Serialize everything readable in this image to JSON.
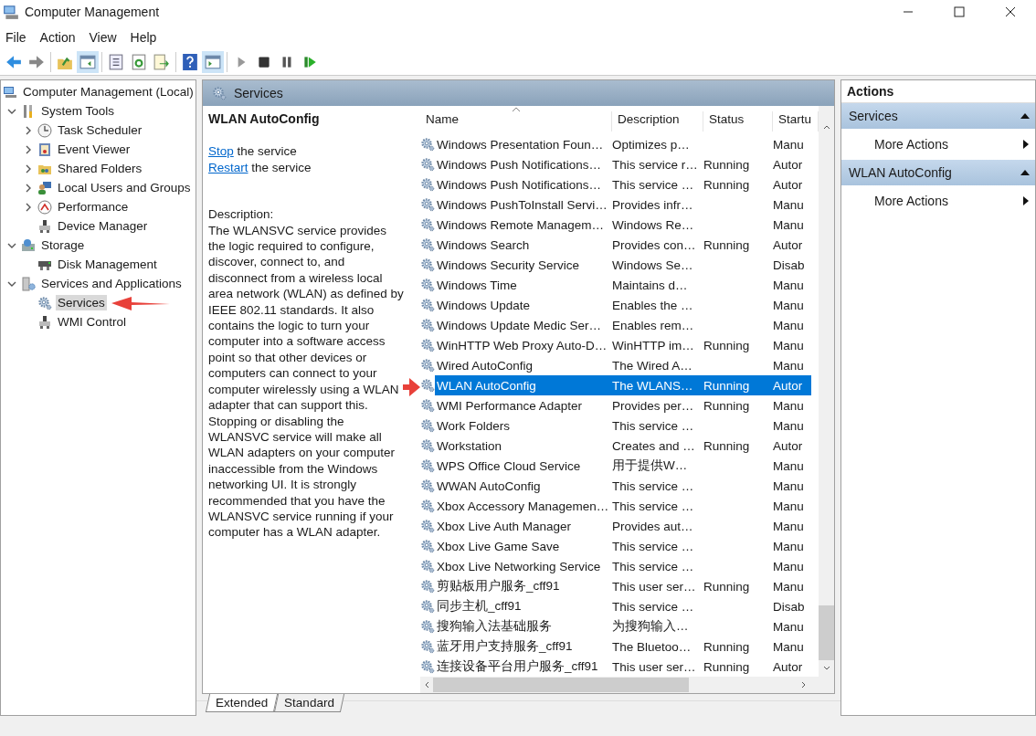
{
  "window": {
    "title": "Computer Management"
  },
  "menu": [
    "File",
    "Action",
    "View",
    "Help"
  ],
  "toolbar": [
    [
      {
        "kind": "back",
        "selected": false
      },
      {
        "kind": "forward",
        "selected": false
      }
    ],
    [
      {
        "kind": "up-folder",
        "selected": false
      },
      {
        "kind": "console-tree",
        "selected": true
      }
    ],
    [
      {
        "kind": "properties",
        "selected": false
      },
      {
        "kind": "refresh",
        "selected": false
      },
      {
        "kind": "export",
        "selected": false
      }
    ],
    [
      {
        "kind": "help",
        "selected": false
      },
      {
        "kind": "action-pane",
        "selected": true
      }
    ],
    [
      {
        "kind": "play",
        "selected": false
      },
      {
        "kind": "stop",
        "selected": false
      },
      {
        "kind": "pause",
        "selected": false
      },
      {
        "kind": "resume",
        "selected": false
      }
    ]
  ],
  "tree": [
    {
      "label": "Computer Management (Local)",
      "kind": "computer",
      "selected": false,
      "children": [
        {
          "label": "System Tools",
          "kind": "tools",
          "expanded": true,
          "selected": false,
          "children": [
            {
              "label": "Task Scheduler",
              "kind": "clock",
              "expanded": false,
              "selected": false
            },
            {
              "label": "Event Viewer",
              "kind": "log",
              "expanded": false,
              "selected": false
            },
            {
              "label": "Shared Folders",
              "kind": "folder",
              "expanded": false,
              "selected": false
            },
            {
              "label": "Local Users and Groups",
              "kind": "users",
              "expanded": false,
              "selected": false
            },
            {
              "label": "Performance",
              "kind": "gauge",
              "expanded": false,
              "selected": false
            },
            {
              "label": "Device Manager",
              "kind": "device",
              "selected": false
            }
          ]
        },
        {
          "label": "Storage",
          "kind": "storage",
          "expanded": true,
          "selected": false,
          "children": [
            {
              "label": "Disk Management",
              "kind": "disk",
              "selected": false
            }
          ]
        },
        {
          "label": "Services and Applications",
          "kind": "server",
          "expanded": true,
          "selected": false,
          "children": [
            {
              "label": "Services",
              "kind": "gear",
              "selected": true
            },
            {
              "label": "WMI Control",
              "kind": "device",
              "selected": false
            }
          ]
        }
      ]
    }
  ],
  "services_panel": {
    "title": "Services",
    "detail": {
      "name": "WLAN AutoConfig",
      "actions": [
        {
          "link": "Stop",
          "text": "the service"
        },
        {
          "link": "Restart",
          "text": "the service"
        }
      ],
      "description_label": "Description:",
      "description": "The WLANSVC service provides the logic required to configure, discover, connect to, and disconnect from a wireless local area network (WLAN) as defined by IEEE 802.11 standards. It also contains the logic to turn your computer into a software access point so that other devices or computers can connect to your computer wirelessly using a WLAN adapter that can support this. Stopping or disabling the WLANSVC service will make all WLAN adapters on your computer inaccessible from the Windows networking UI. It is strongly recommended that you have the WLANSVC service running if your computer has a WLAN adapter."
    },
    "table": {
      "columns": [
        "Name",
        "Description",
        "Status",
        "Startu"
      ],
      "rows": [
        {
          "name": "Windows Presentation Foun…",
          "description": "Optimizes p…",
          "startup": "Manu",
          "selected": false
        },
        {
          "name": "Windows Push Notifications…",
          "description": "This service r…",
          "status": "Running",
          "startup": "Autor",
          "selected": false
        },
        {
          "name": "Windows Push Notifications…",
          "description": "This service …",
          "status": "Running",
          "startup": "Autor",
          "selected": false
        },
        {
          "name": "Windows PushToInstall Servi…",
          "description": "Provides infr…",
          "startup": "Manu",
          "selected": false
        },
        {
          "name": "Windows Remote Managem…",
          "description": "Windows Re…",
          "startup": "Manu",
          "selected": false
        },
        {
          "name": "Windows Search",
          "description": "Provides con…",
          "status": "Running",
          "startup": "Autor",
          "selected": false
        },
        {
          "name": "Windows Security Service",
          "description": "Windows Se…",
          "startup": "Disab",
          "selected": false
        },
        {
          "name": "Windows Time",
          "description": "Maintains d…",
          "startup": "Manu",
          "selected": false
        },
        {
          "name": "Windows Update",
          "description": "Enables the …",
          "startup": "Manu",
          "selected": false
        },
        {
          "name": "Windows Update Medic Ser…",
          "description": "Enables rem…",
          "startup": "Manu",
          "selected": false
        },
        {
          "name": "WinHTTP Web Proxy Auto-D…",
          "description": "WinHTTP im…",
          "status": "Running",
          "startup": "Manu",
          "selected": false
        },
        {
          "name": "Wired AutoConfig",
          "description": "The Wired A…",
          "startup": "Manu",
          "selected": false
        },
        {
          "name": "WLAN AutoConfig",
          "description": "The WLANS…",
          "status": "Running",
          "startup": "Autor",
          "selected": true
        },
        {
          "name": "WMI Performance Adapter",
          "description": "Provides per…",
          "status": "Running",
          "startup": "Manu",
          "selected": false
        },
        {
          "name": "Work Folders",
          "description": "This service …",
          "startup": "Manu",
          "selected": false
        },
        {
          "name": "Workstation",
          "description": "Creates and …",
          "status": "Running",
          "startup": "Autor",
          "selected": false
        },
        {
          "name": "WPS Office Cloud Service",
          "description": "用于提供W…",
          "startup": "Manu",
          "selected": false
        },
        {
          "name": "WWAN AutoConfig",
          "description": "This service …",
          "startup": "Manu",
          "selected": false
        },
        {
          "name": "Xbox Accessory Managemen…",
          "description": "This service …",
          "startup": "Manu",
          "selected": false
        },
        {
          "name": "Xbox Live Auth Manager",
          "description": "Provides aut…",
          "startup": "Manu",
          "selected": false
        },
        {
          "name": "Xbox Live Game Save",
          "description": "This service …",
          "startup": "Manu",
          "selected": false
        },
        {
          "name": "Xbox Live Networking Service",
          "description": "This service …",
          "startup": "Manu",
          "selected": false
        },
        {
          "name": "剪贴板用户服务_cff91",
          "description": "This user ser…",
          "status": "Running",
          "startup": "Manu",
          "selected": false
        },
        {
          "name": "同步主机_cff91",
          "description": "This service …",
          "startup": "Disab",
          "selected": false
        },
        {
          "name": "搜狗输入法基础服务",
          "description": "为搜狗输入…",
          "startup": "Manu",
          "selected": false
        },
        {
          "name": "蓝牙用户支持服务_cff91",
          "description": "The Bluetoo…",
          "status": "Running",
          "startup": "Manu",
          "selected": false
        },
        {
          "name": "连接设备平台用户服务_cff91",
          "description": "This user ser…",
          "status": "Running",
          "startup": "Autor",
          "selected": false
        }
      ]
    },
    "tabs": [
      {
        "label": "Extended",
        "selected": true
      },
      {
        "label": "Standard",
        "selected": false
      }
    ]
  },
  "actions": {
    "title": "Actions",
    "sections": [
      {
        "title": "Services",
        "items": [
          "More Actions"
        ]
      },
      {
        "title": "WLAN AutoConfig",
        "items": [
          "More Actions"
        ]
      }
    ]
  }
}
